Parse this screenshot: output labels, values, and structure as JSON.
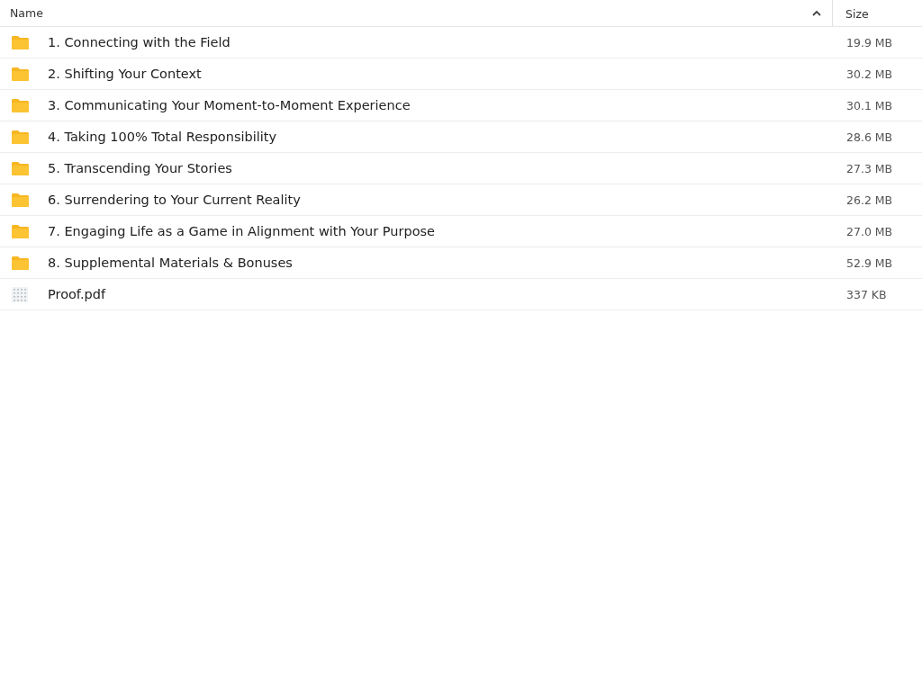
{
  "columns": [
    {
      "label": "Name",
      "sort_ascending": true
    },
    {
      "label": "Size"
    }
  ],
  "rows": [
    {
      "kind": "folder",
      "name": "1. Connecting with the Field",
      "size": "19.9 MB"
    },
    {
      "kind": "folder",
      "name": "2. Shifting Your Context",
      "size": "30.2 MB"
    },
    {
      "kind": "folder",
      "name": "3. Communicating Your Moment-to-Moment Experience",
      "size": "30.1 MB"
    },
    {
      "kind": "folder",
      "name": "4. Taking 100% Total Responsibility",
      "size": "28.6 MB"
    },
    {
      "kind": "folder",
      "name": "5. Transcending Your Stories",
      "size": "27.3 MB"
    },
    {
      "kind": "folder",
      "name": "6. Surrendering to Your Current Reality",
      "size": "26.2 MB"
    },
    {
      "kind": "folder",
      "name": "7. Engaging Life as a Game in Alignment with Your Purpose",
      "size": "27.0 MB"
    },
    {
      "kind": "folder",
      "name": "8. Supplemental Materials & Bonuses",
      "size": "52.9 MB"
    },
    {
      "kind": "pdf",
      "name": "Proof.pdf",
      "size": "337 KB"
    }
  ]
}
